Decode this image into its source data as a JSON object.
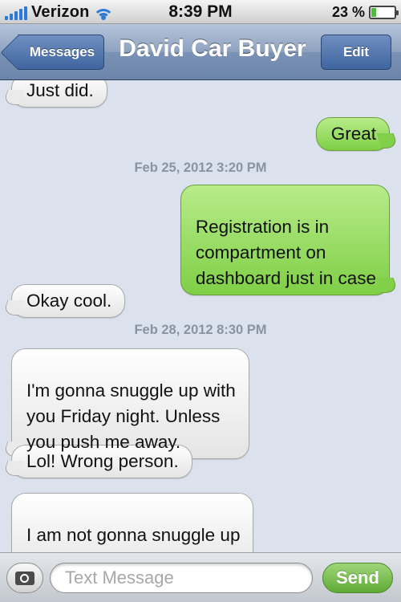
{
  "status_bar": {
    "carrier": "Verizon",
    "time": "8:39 PM",
    "battery_percent": "23 %",
    "battery_level": 0.23,
    "signal_bars": 5
  },
  "nav": {
    "back_label": "Messages",
    "title": "David Car Buyer",
    "edit_label": "Edit"
  },
  "messages": [
    {
      "direction": "incoming",
      "text": "Just did."
    },
    {
      "direction": "outgoing",
      "text": "Great"
    },
    {
      "type": "timestamp",
      "text": "Feb 25, 2012 3:20 PM"
    },
    {
      "direction": "outgoing",
      "text": "Registration is in\ncompartment on\ndashboard just in case"
    },
    {
      "direction": "incoming",
      "text": "Okay cool."
    },
    {
      "type": "timestamp",
      "text": "Feb 28, 2012 8:30 PM"
    },
    {
      "direction": "incoming",
      "text": "I'm gonna snuggle up with\nyou Friday night. Unless\nyou push me away."
    },
    {
      "direction": "incoming",
      "text": "Lol! Wrong person."
    },
    {
      "direction": "incoming",
      "text": "I am not gonna snuggle up\nwith you man."
    }
  ],
  "input": {
    "placeholder": "Text Message",
    "value": "",
    "send_label": "Send",
    "camera_icon": "camera-icon"
  },
  "colors": {
    "outgoing_bubble": "#7fcf46",
    "incoming_bubble": "#ffffff",
    "background": "#dbe2ed",
    "nav_bar": "#7a92b5",
    "send_button": "#5faa36"
  }
}
